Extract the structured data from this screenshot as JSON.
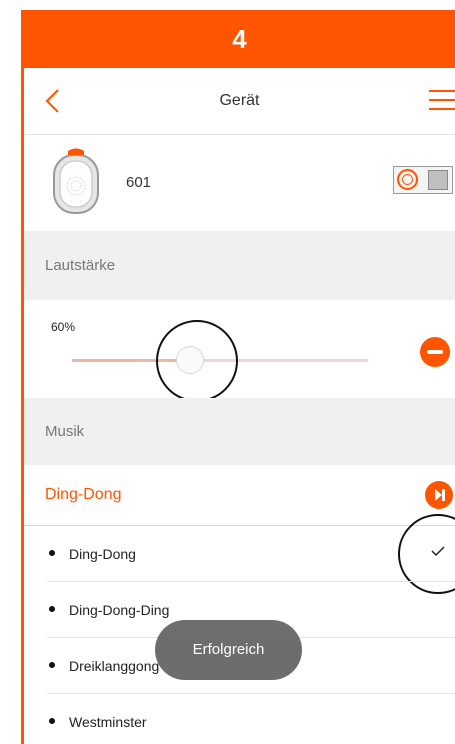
{
  "step_number": "4",
  "header": {
    "title": "Gerät"
  },
  "device": {
    "name": "601"
  },
  "volume": {
    "section_label": "Lautstärke",
    "value_label": "60%",
    "level": 0.4
  },
  "music": {
    "section_label": "Musik",
    "selected_tone": "Ding-Dong",
    "items": [
      {
        "label": "Ding-Dong",
        "selected": true
      },
      {
        "label": "Ding-Dong-Ding",
        "selected": false
      },
      {
        "label": "Dreiklanggong",
        "selected": false
      },
      {
        "label": "Westminster",
        "selected": false
      }
    ]
  },
  "toast": {
    "text": "Erfolgreich"
  },
  "icons": {
    "back": "chevron-left-icon",
    "menu": "hamburger-menu-icon",
    "device": "doorbell-device-icon",
    "volume_down": "minus-circle-icon",
    "play": "play-skip-icon",
    "selected": "checkmark-icon"
  },
  "colors": {
    "accent": "#ff5500",
    "section_bg": "#f0f0f0",
    "toast_bg": "#666666"
  }
}
